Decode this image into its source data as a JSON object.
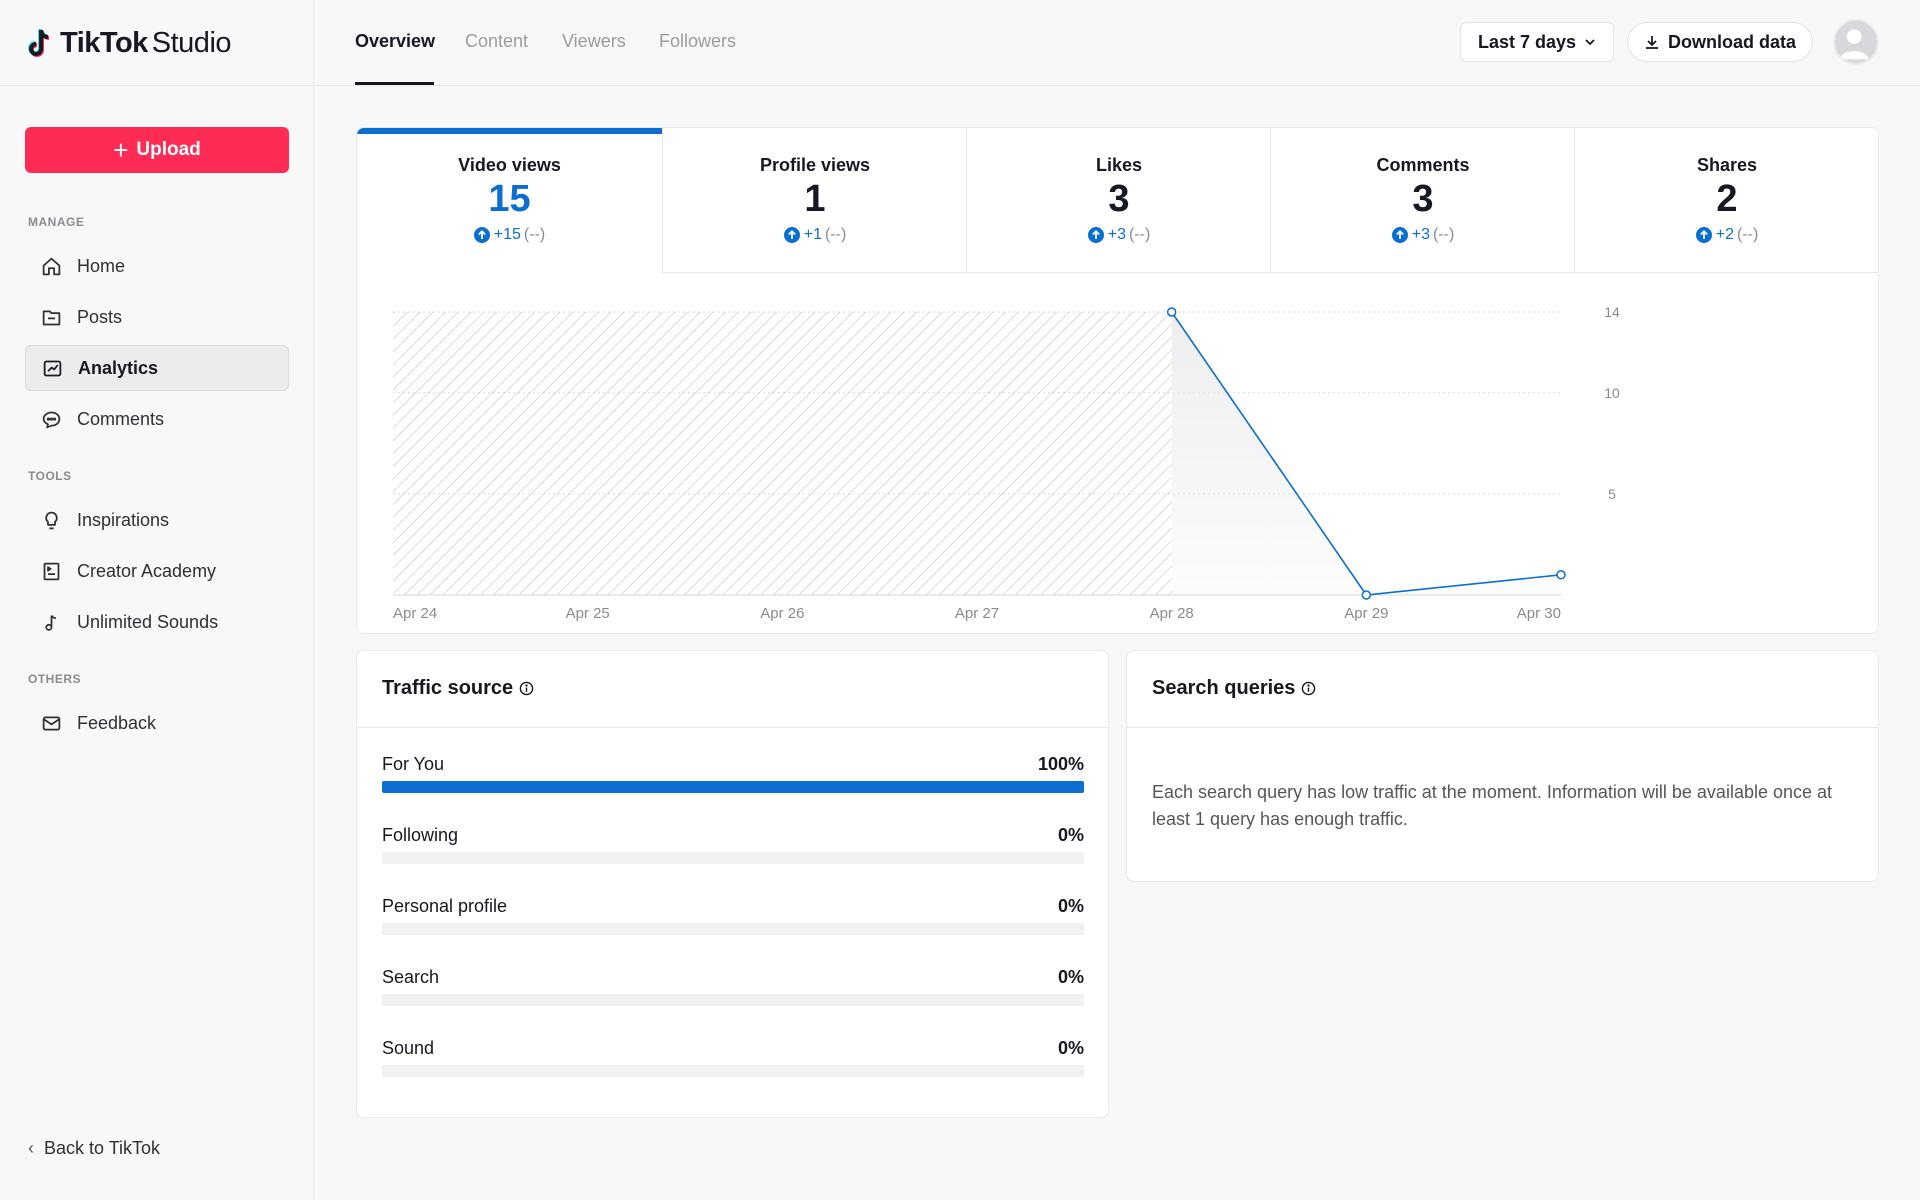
{
  "brand": {
    "name_bold": "TikTok",
    "name_light": "Studio"
  },
  "sidebar": {
    "upload_label": "Upload",
    "sections": {
      "manage": "MANAGE",
      "tools": "TOOLS",
      "others": "OTHERS"
    },
    "items": {
      "home": "Home",
      "posts": "Posts",
      "analytics": "Analytics",
      "comments": "Comments",
      "inspirations": "Inspirations",
      "creator_academy": "Creator Academy",
      "unlimited_sounds": "Unlimited Sounds",
      "feedback": "Feedback"
    },
    "active_item": "analytics",
    "back_label": "Back to TikTok"
  },
  "header": {
    "tabs": [
      "Overview",
      "Content",
      "Viewers",
      "Followers"
    ],
    "active_tab": "Overview",
    "range_label": "Last 7 days",
    "download_label": "Download data"
  },
  "metrics": [
    {
      "label": "Video views",
      "value": "15",
      "delta": "+15",
      "prev": "(--)",
      "active": true
    },
    {
      "label": "Profile views",
      "value": "1",
      "delta": "+1",
      "prev": "(--)",
      "active": false
    },
    {
      "label": "Likes",
      "value": "3",
      "delta": "+3",
      "prev": "(--)",
      "active": false
    },
    {
      "label": "Comments",
      "value": "3",
      "delta": "+3",
      "prev": "(--)",
      "active": false
    },
    {
      "label": "Shares",
      "value": "2",
      "delta": "+2",
      "prev": "(--)",
      "active": false
    }
  ],
  "chart_data": {
    "type": "line",
    "categories": [
      "Apr 24",
      "Apr 25",
      "Apr 26",
      "Apr 27",
      "Apr 28",
      "Apr 29",
      "Apr 30"
    ],
    "series": [
      {
        "values": [
          null,
          null,
          null,
          null,
          14,
          0,
          1
        ]
      }
    ],
    "y_ticks": [
      14,
      10,
      5
    ],
    "ylim": [
      0,
      14
    ],
    "no_data_range": [
      "Apr 24",
      "Apr 28"
    ],
    "color": "#0b6fd1"
  },
  "traffic": {
    "title": "Traffic source",
    "rows": [
      {
        "name": "For You",
        "pct_label": "100%",
        "pct": 100
      },
      {
        "name": "Following",
        "pct_label": "0%",
        "pct": 0
      },
      {
        "name": "Personal profile",
        "pct_label": "0%",
        "pct": 0
      },
      {
        "name": "Search",
        "pct_label": "0%",
        "pct": 0
      },
      {
        "name": "Sound",
        "pct_label": "0%",
        "pct": 0
      }
    ]
  },
  "search": {
    "title": "Search queries",
    "message": "Each search query has low traffic at the moment. Information will be available once at least 1 query has enough traffic."
  }
}
